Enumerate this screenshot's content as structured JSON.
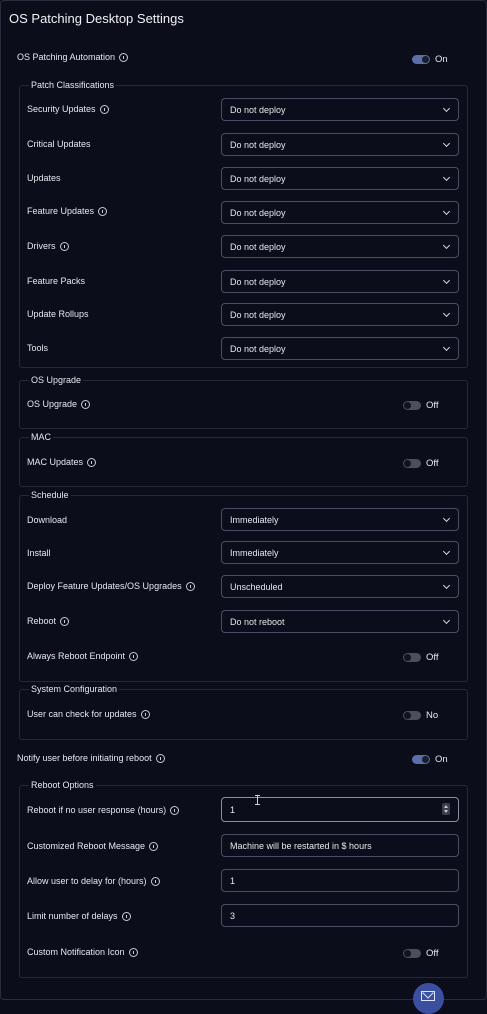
{
  "page": {
    "title": "OS Patching Desktop Settings"
  },
  "automation": {
    "label": "OS Patching Automation",
    "toggle": "On"
  },
  "patch": {
    "legend": "Patch Classifications",
    "rows": [
      {
        "label": "Security Updates",
        "value": "Do not deploy"
      },
      {
        "label": "Critical Updates",
        "value": "Do not deploy"
      },
      {
        "label": "Updates",
        "value": "Do not deploy"
      },
      {
        "label": "Feature Updates",
        "value": "Do not deploy"
      },
      {
        "label": "Drivers",
        "value": "Do not deploy"
      },
      {
        "label": "Feature Packs",
        "value": "Do not deploy"
      },
      {
        "label": "Update Rollups",
        "value": "Do not deploy"
      },
      {
        "label": "Tools",
        "value": "Do not deploy"
      }
    ]
  },
  "os_upgrade": {
    "legend": "OS Upgrade",
    "label": "OS Upgrade",
    "toggle": "Off"
  },
  "mac": {
    "legend": "MAC",
    "label": "MAC Updates",
    "toggle": "Off"
  },
  "schedule": {
    "legend": "Schedule",
    "download": {
      "label": "Download",
      "value": "Immediately"
    },
    "install": {
      "label": "Install",
      "value": "Immediately"
    },
    "deploy": {
      "label": "Deploy Feature Updates/OS Upgrades",
      "value": "Unscheduled"
    },
    "reboot": {
      "label": "Reboot",
      "value": "Do not reboot"
    },
    "always_reboot": {
      "label": "Always Reboot Endpoint",
      "toggle": "Off"
    }
  },
  "system": {
    "legend": "System Configuration",
    "label": "User can check for updates",
    "toggle": "No"
  },
  "notify": {
    "label": "Notify user before initiating reboot",
    "toggle": "On"
  },
  "reboot_options": {
    "legend": "Reboot Options",
    "no_response": {
      "label": "Reboot if no user response (hours)",
      "value": "1"
    },
    "message": {
      "label": "Customized Reboot Message",
      "value": "Machine will be restarted in $ hours"
    },
    "delay": {
      "label": "Allow user to delay for (hours)",
      "value": "1"
    },
    "limit": {
      "label": "Limit number of delays",
      "value": "3"
    },
    "icon": {
      "label": "Custom Notification Icon",
      "toggle": "Off"
    }
  }
}
